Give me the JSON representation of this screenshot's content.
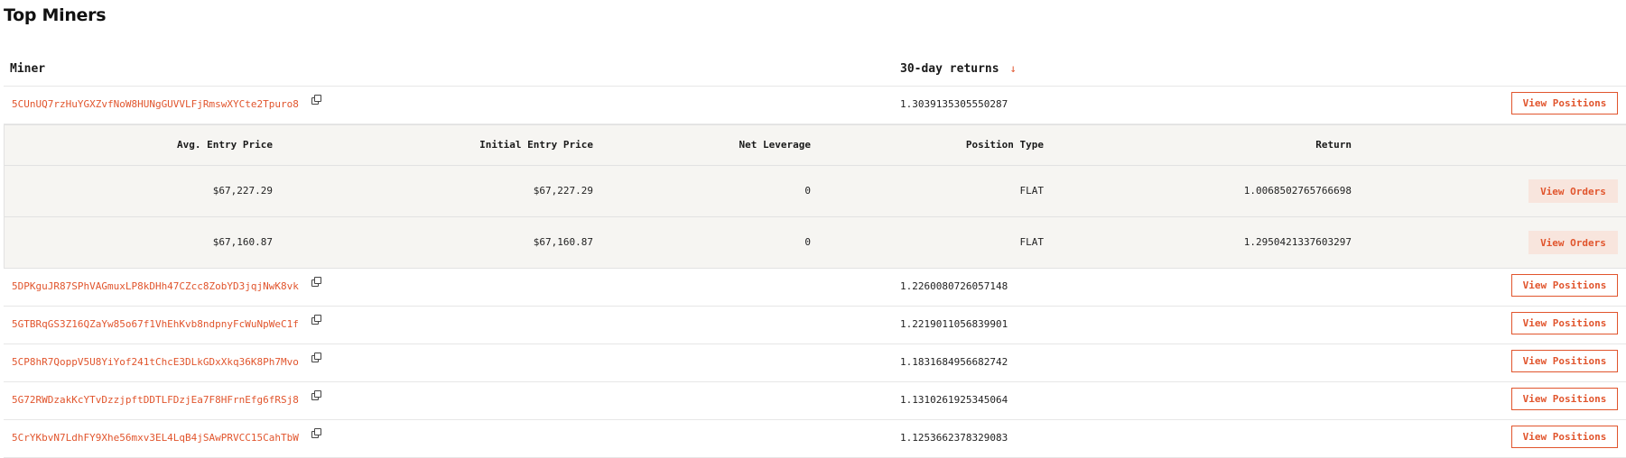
{
  "page": {
    "title": "Top Miners"
  },
  "table": {
    "columns": {
      "miner": "Miner",
      "returns": "30-day returns",
      "sort_icon": "↓"
    },
    "view_positions_label": "View Positions",
    "rows": [
      {
        "miner": "5CUnUQ7rzHuYGXZvfNoW8HUNgGUVVLFjRmswXYCte2Tpuro8",
        "returns": "1.3039135305550287"
      },
      {
        "miner": "5DPKguJR87SPhVAGmuxLP8kDHh47CZcc8ZobYD3jqjNwK8vk",
        "returns": "1.2260080726057148"
      },
      {
        "miner": "5GTBRqGS3Z16QZaYw85o67f1VhEhKvb8ndpnyFcWuNpWeC1f",
        "returns": "1.2219011056839901"
      },
      {
        "miner": "5CP8hR7QoppV5U8YiYof241tChcE3DLkGDxXkq36K8Ph7Mvo",
        "returns": "1.1831684956682742"
      },
      {
        "miner": "5G72RWDzakKcYTvDzzjpftDDTLFDzjEa7F8HFrnEfg6fRSj8",
        "returns": "1.1310261925345064"
      },
      {
        "miner": "5CrYKbvN7LdhFY9Xhe56mxv3EL4LqB4jSAwPRVCC15CahTbW",
        "returns": "1.1253662378329083"
      }
    ]
  },
  "positions": {
    "headers": {
      "avg_entry": "Avg. Entry Price",
      "initial_entry": "Initial Entry Price",
      "net_leverage": "Net Leverage",
      "position_type": "Position Type",
      "return": "Return"
    },
    "view_orders_label": "View Orders",
    "rows": [
      {
        "avg_entry": "$67,227.29",
        "initial_entry": "$67,227.29",
        "net_leverage": "0",
        "position_type": "FLAT",
        "return": "1.0068502765766698"
      },
      {
        "avg_entry": "$67,160.87",
        "initial_entry": "$67,160.87",
        "net_leverage": "0",
        "position_type": "FLAT",
        "return": "1.2950421337603297"
      }
    ]
  },
  "colors": {
    "accent": "#e1552d",
    "subtable_bg": "#f6f5f2",
    "orders_button_bg": "#f8e5dd"
  },
  "icons": {
    "copy": "copy-icon",
    "sort": "arrow-down-icon"
  }
}
